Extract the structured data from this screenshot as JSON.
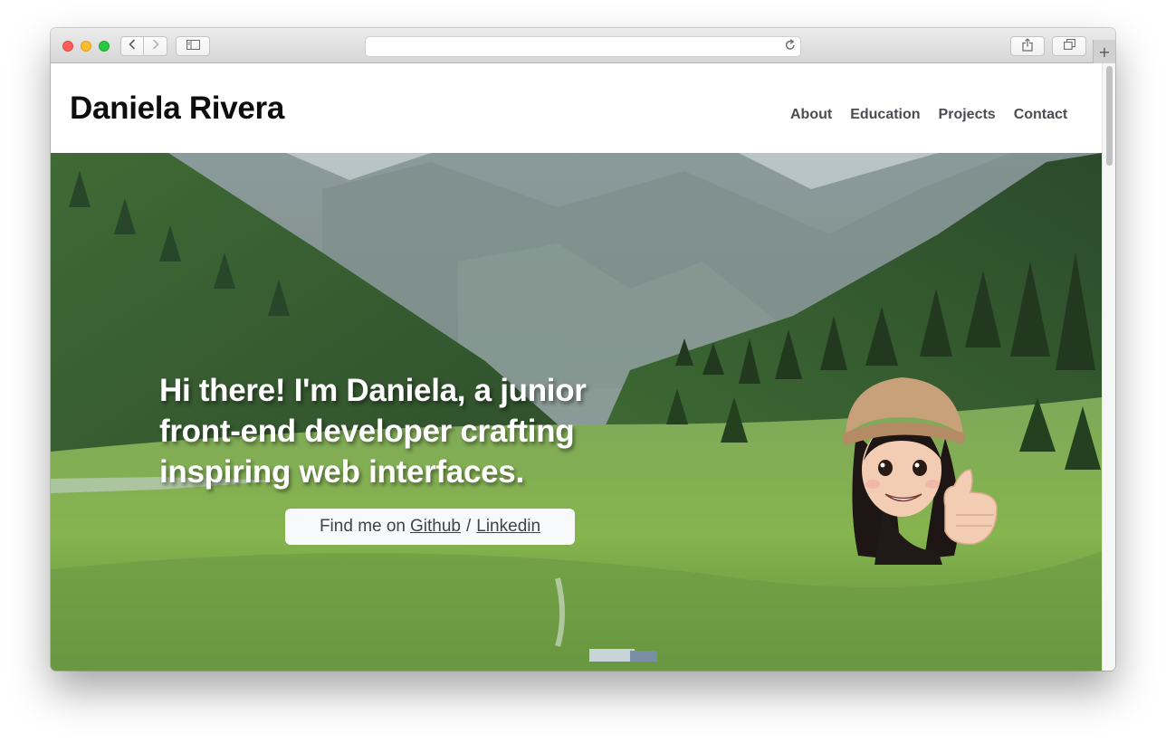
{
  "site": {
    "name": "Daniela Rivera"
  },
  "nav": {
    "items": [
      "About",
      "Education",
      "Projects",
      "Contact"
    ]
  },
  "hero": {
    "headline": "Hi there! I'm Daniela, a junior front-end developer crafting inspiring web interfaces.",
    "find_prefix": "Find me on",
    "github_label": "Github",
    "separator": "/",
    "linkedin_label": "Linkedin"
  },
  "browser": {
    "new_tab_label": "+"
  },
  "colors": {
    "link": "#4a4d52",
    "hero_text": "#ffffff",
    "find_box_bg": "#f7f9fb"
  }
}
